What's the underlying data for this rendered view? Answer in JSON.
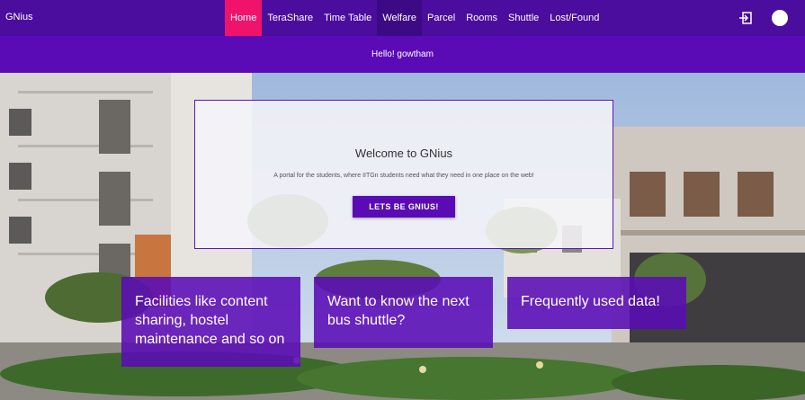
{
  "nav": {
    "brand": "GNius",
    "links": [
      {
        "label": "Home",
        "state": "active"
      },
      {
        "label": "TeraShare",
        "state": ""
      },
      {
        "label": "Time Table",
        "state": ""
      },
      {
        "label": "Welfare",
        "state": "hover"
      },
      {
        "label": "Parcel",
        "state": ""
      },
      {
        "label": "Rooms",
        "state": ""
      },
      {
        "label": "Shuttle",
        "state": ""
      },
      {
        "label": "Lost/Found",
        "state": ""
      }
    ],
    "icons": {
      "logout": "logout-icon",
      "avatar": "avatar"
    }
  },
  "greeting": "Hello! gowtham",
  "welcome": {
    "title": "Welcome to GNius",
    "subtitle": "A portal for the students, where IITGn students need what they need in one place on the web!",
    "button_label": "LETS BE GNIUS!"
  },
  "tiles": [
    {
      "text": "Facilities like content sharing, hostel maintenance and so on"
    },
    {
      "text": "Want to know the next bus shuttle?"
    },
    {
      "text": "Frequently used data!"
    }
  ],
  "colors": {
    "nav_bg": "#4a0d9e",
    "band_bg": "#5a0bb5",
    "active": "#f0136b",
    "accent": "#5a0bb5"
  }
}
